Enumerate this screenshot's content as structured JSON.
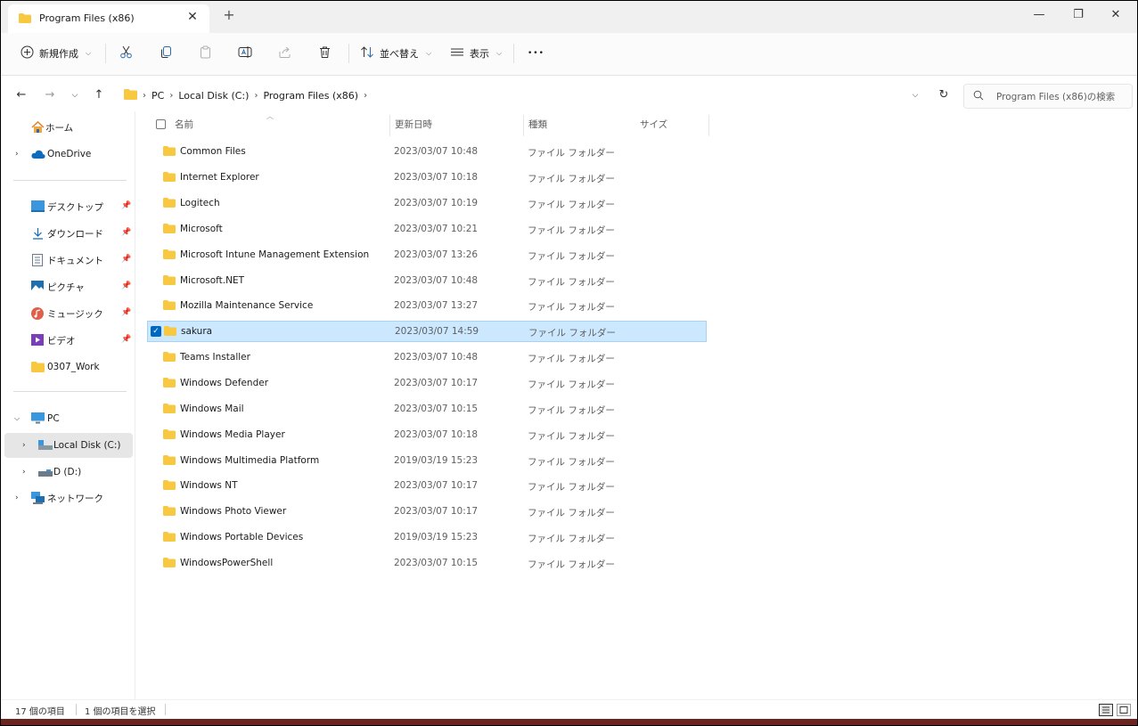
{
  "window": {
    "tab_title": "Program Files (x86)",
    "tab_close": "✕",
    "tab_add": "+",
    "minimize": "—",
    "restore": "❐",
    "close": "✕"
  },
  "toolbar": {
    "new_label": "新規作成",
    "sort_label": "並べ替え",
    "view_label": "表示",
    "more_label": "•••"
  },
  "address": {
    "crumbs": [
      "PC",
      "Local Disk (C:)",
      "Program Files (x86)"
    ],
    "search_placeholder": "Program Files (x86)の検索"
  },
  "sidebar": {
    "home": "ホーム",
    "onedrive": "OneDrive",
    "quick": [
      {
        "label": "デスクトップ",
        "icon": "desktop-icon"
      },
      {
        "label": "ダウンロード",
        "icon": "download-icon"
      },
      {
        "label": "ドキュメント",
        "icon": "document-icon"
      },
      {
        "label": "ピクチャ",
        "icon": "picture-icon"
      },
      {
        "label": "ミュージック",
        "icon": "music-icon"
      },
      {
        "label": "ビデオ",
        "icon": "video-icon"
      },
      {
        "label": "0307_Work",
        "icon": "folder-icon"
      }
    ],
    "pc": "PC",
    "local_disk": "Local Disk (C:)",
    "d_drive": "D (D:)",
    "network": "ネットワーク"
  },
  "columns": {
    "name": "名前",
    "date": "更新日時",
    "type": "種類",
    "size": "サイズ"
  },
  "files": [
    {
      "name": "Common Files",
      "date": "2023/03/07 10:48",
      "type": "ファイル フォルダー"
    },
    {
      "name": "Internet Explorer",
      "date": "2023/03/07 10:18",
      "type": "ファイル フォルダー"
    },
    {
      "name": "Logitech",
      "date": "2023/03/07 10:19",
      "type": "ファイル フォルダー"
    },
    {
      "name": "Microsoft",
      "date": "2023/03/07 10:21",
      "type": "ファイル フォルダー"
    },
    {
      "name": "Microsoft Intune Management Extension",
      "date": "2023/03/07 13:26",
      "type": "ファイル フォルダー"
    },
    {
      "name": "Microsoft.NET",
      "date": "2023/03/07 10:48",
      "type": "ファイル フォルダー"
    },
    {
      "name": "Mozilla Maintenance Service",
      "date": "2023/03/07 13:27",
      "type": "ファイル フォルダー"
    },
    {
      "name": "sakura",
      "date": "2023/03/07 14:59",
      "type": "ファイル フォルダー"
    },
    {
      "name": "Teams Installer",
      "date": "2023/03/07 10:48",
      "type": "ファイル フォルダー"
    },
    {
      "name": "Windows Defender",
      "date": "2023/03/07 10:17",
      "type": "ファイル フォルダー"
    },
    {
      "name": "Windows Mail",
      "date": "2023/03/07 10:15",
      "type": "ファイル フォルダー"
    },
    {
      "name": "Windows Media Player",
      "date": "2023/03/07 10:18",
      "type": "ファイル フォルダー"
    },
    {
      "name": "Windows Multimedia Platform",
      "date": "2019/03/19 15:23",
      "type": "ファイル フォルダー"
    },
    {
      "name": "Windows NT",
      "date": "2023/03/07 10:17",
      "type": "ファイル フォルダー"
    },
    {
      "name": "Windows Photo Viewer",
      "date": "2023/03/07 10:17",
      "type": "ファイル フォルダー"
    },
    {
      "name": "Windows Portable Devices",
      "date": "2019/03/19 15:23",
      "type": "ファイル フォルダー"
    },
    {
      "name": "WindowsPowerShell",
      "date": "2023/03/07 10:15",
      "type": "ファイル フォルダー"
    }
  ],
  "status": {
    "count": "17 個の項目",
    "selected": "1 個の項目を選択"
  },
  "colors": {
    "accent": "#0067c0",
    "folder": "#f8c840",
    "selection": "#cce8ff"
  }
}
